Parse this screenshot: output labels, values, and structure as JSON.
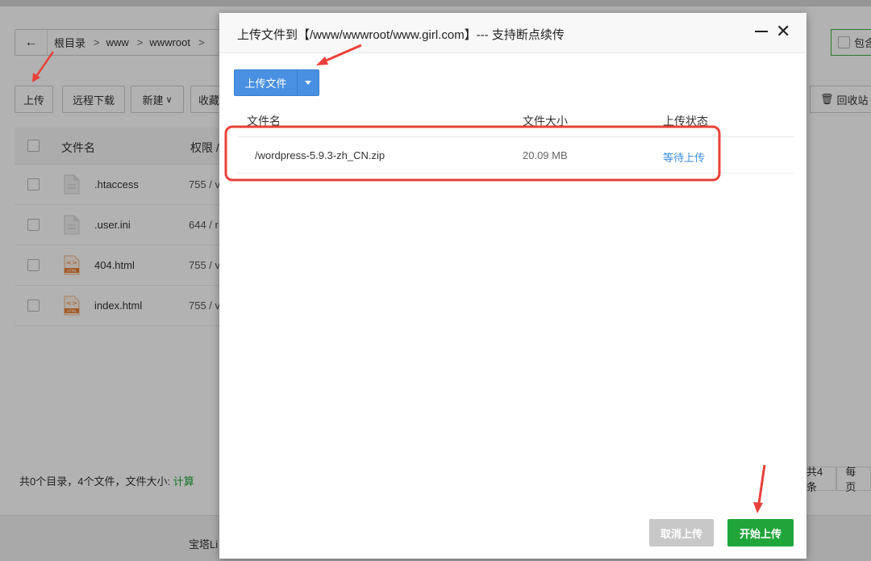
{
  "background": {
    "breadcrumb": [
      "根目录",
      "www",
      "wwwroot"
    ],
    "include_sub_label": "包含",
    "toolbar": {
      "upload": "上传",
      "remote_download": "远程下载",
      "new": "新建",
      "favorites": "收藏",
      "recycle_bin": "回收站"
    },
    "table": {
      "col_name": "文件名",
      "col_perm": "权限 /",
      "rows": [
        {
          "name": ".htaccess",
          "perm": "755 / v",
          "type": "text"
        },
        {
          "name": ".user.ini",
          "perm": "644 / r",
          "type": "text"
        },
        {
          "name": "404.html",
          "perm": "755 / v",
          "type": "html"
        },
        {
          "name": "index.html",
          "perm": "755 / v",
          "type": "html"
        }
      ]
    },
    "summary_text": "共0个目录，4个文件，文件大小:",
    "summary_calc": "计算",
    "pager": {
      "total": "共4条",
      "per_page": "每页"
    },
    "footer_text": "宝塔Li"
  },
  "modal": {
    "title": "上传文件到【/www/wwwroot/www.girl.com】--- 支持断点续传",
    "upload_button": "上传文件",
    "columns": {
      "name": "文件名",
      "size": "文件大小",
      "status": "上传状态"
    },
    "files": [
      {
        "name": "/wordpress-5.9.3-zh_CN.zip",
        "size": "20.09 MB",
        "status": "等待上传"
      }
    ],
    "cancel_button": "取消上传",
    "start_button": "开始上传"
  },
  "colors": {
    "accent_blue": "#4a90e2",
    "start_green": "#20a53a",
    "annotation_red": "#e8413a"
  }
}
